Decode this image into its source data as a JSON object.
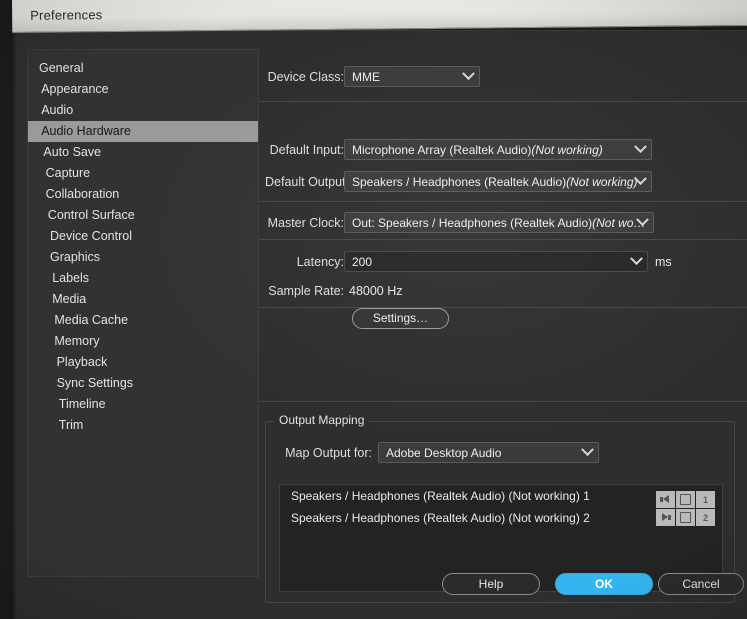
{
  "window": {
    "title": "Preferences"
  },
  "sidebar": {
    "items": [
      {
        "label": "General",
        "selected": false,
        "indent": 0
      },
      {
        "label": "Appearance",
        "selected": false,
        "indent": 1
      },
      {
        "label": "Audio",
        "selected": false,
        "indent": 1
      },
      {
        "label": "Audio Hardware",
        "selected": true,
        "indent": 1
      },
      {
        "label": "Auto Save",
        "selected": false,
        "indent": 2
      },
      {
        "label": "Capture",
        "selected": false,
        "indent": 3
      },
      {
        "label": "Collaboration",
        "selected": false,
        "indent": 3
      },
      {
        "label": "Control Surface",
        "selected": false,
        "indent": 4
      },
      {
        "label": "Device Control",
        "selected": false,
        "indent": 5
      },
      {
        "label": "Graphics",
        "selected": false,
        "indent": 5
      },
      {
        "label": "Labels",
        "selected": false,
        "indent": 6
      },
      {
        "label": "Media",
        "selected": false,
        "indent": 6
      },
      {
        "label": "Media Cache",
        "selected": false,
        "indent": 7
      },
      {
        "label": "Memory",
        "selected": false,
        "indent": 7
      },
      {
        "label": "Playback",
        "selected": false,
        "indent": 8
      },
      {
        "label": "Sync Settings",
        "selected": false,
        "indent": 8
      },
      {
        "label": "Timeline",
        "selected": false,
        "indent": 9
      },
      {
        "label": "Trim",
        "selected": false,
        "indent": 9
      }
    ]
  },
  "audio_hardware": {
    "device_class": {
      "label": "Device Class:",
      "value": "MME",
      "icon": "chevron-down-icon"
    },
    "default_input": {
      "label": "Default Input:",
      "value": "Microphone Array (Realtek Audio) ",
      "value_italic": "(Not working)",
      "icon": "chevron-down-icon"
    },
    "default_output": {
      "label": "Default Output:",
      "value": "Speakers / Headphones (Realtek Audio) ",
      "value_italic": "(Not working)",
      "icon": "chevron-down-icon"
    },
    "master_clock": {
      "label": "Master Clock:",
      "value": "Out: Speakers / Headphones (Realtek Audio) ",
      "value_italic": "(Not wo…",
      "icon": "chevron-down-icon"
    },
    "latency": {
      "label": "Latency:",
      "value": "200",
      "unit": "ms",
      "icon": "chevron-down-icon"
    },
    "sample_rate": {
      "label": "Sample Rate:",
      "value": "48000 Hz"
    },
    "settings_button": {
      "label": "Settings…"
    }
  },
  "output_mapping": {
    "group_label": "Output Mapping",
    "map_output_for": {
      "label": "Map Output for:",
      "value": "Adobe Desktop Audio",
      "icon": "chevron-down-icon"
    },
    "rows": [
      {
        "label": "Speakers / Headphones (Realtek Audio) (Not working) 1",
        "icon_a": "speaker-right-icon",
        "icon_b": "channel-box-icon",
        "channel": "1"
      },
      {
        "label": "Speakers / Headphones (Realtek Audio) (Not working) 2",
        "icon_a": "speaker-left-icon",
        "icon_b": "channel-box-icon",
        "channel": "2"
      }
    ]
  },
  "footer": {
    "help": "Help",
    "ok": "OK",
    "cancel": "Cancel"
  },
  "colors": {
    "accent": "#35b5ef",
    "dialog_bg": "#2e2e2e",
    "list_bg": "#232323",
    "selection": "#9a9a9a",
    "titlebar": "#e9e7e3"
  }
}
